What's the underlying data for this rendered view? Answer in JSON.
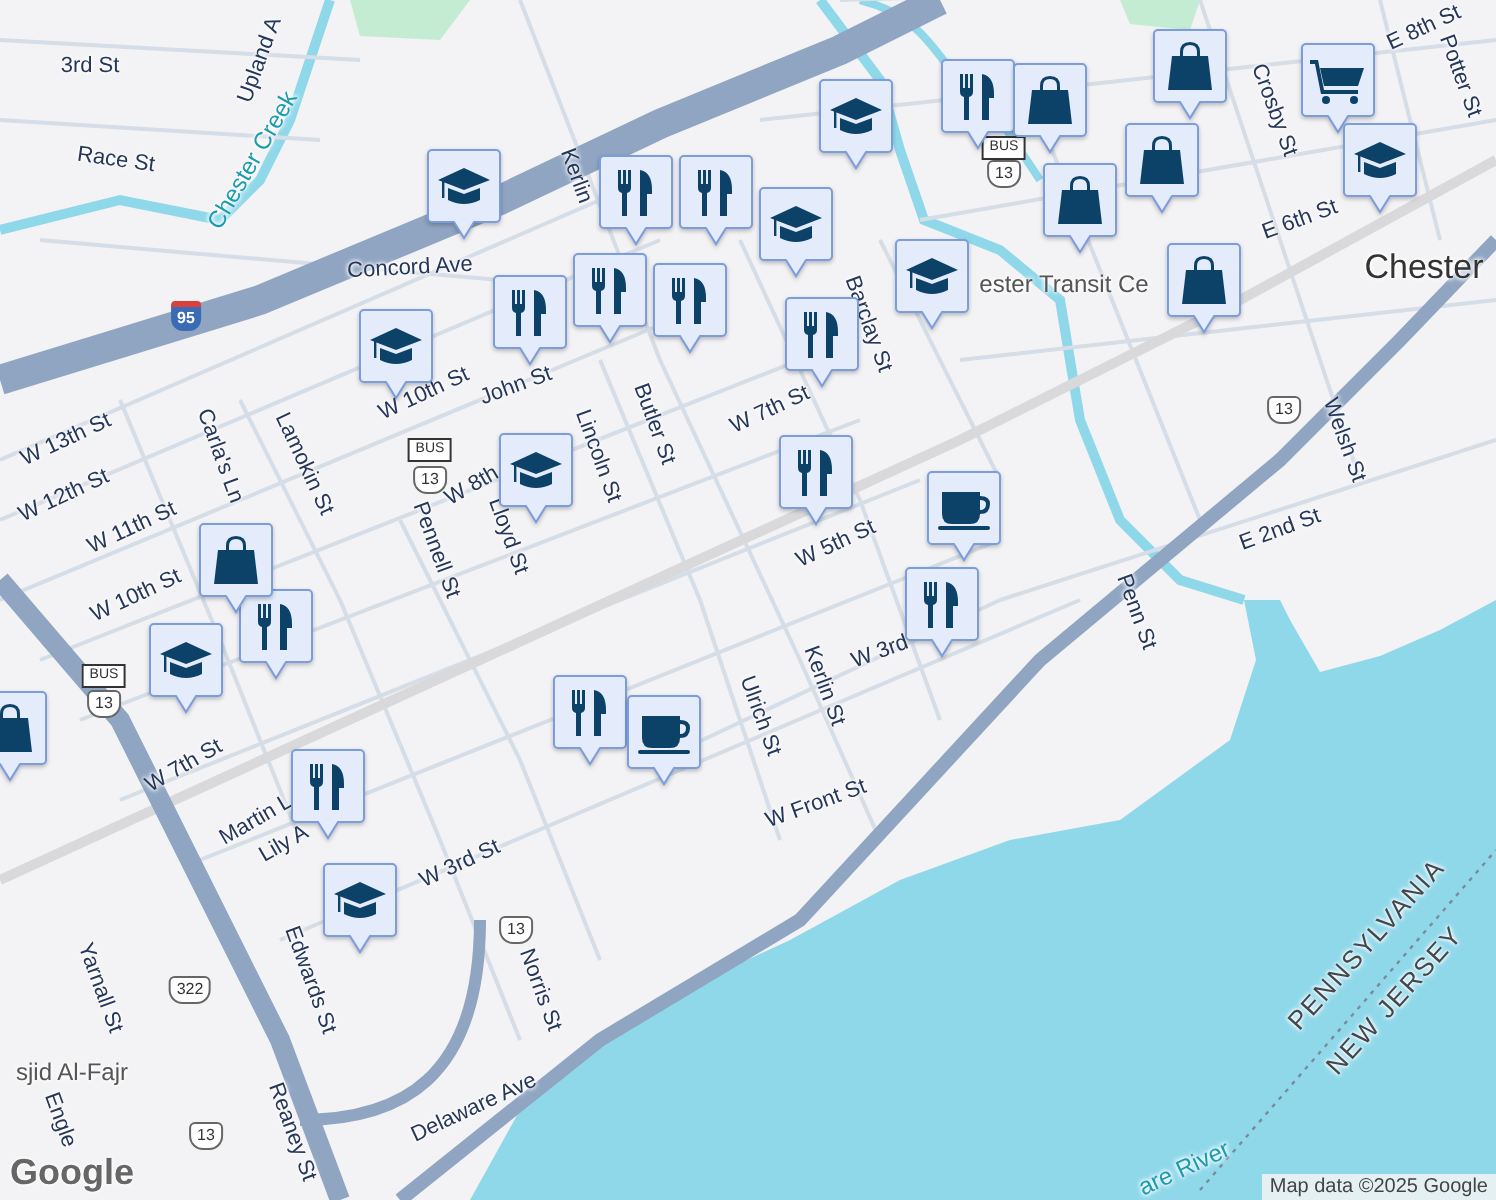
{
  "map": {
    "labels": [
      {
        "text": "3rd St",
        "kind": "street"
      },
      {
        "text": "Race St",
        "kind": "street"
      },
      {
        "text": "Upland A",
        "kind": "street"
      },
      {
        "text": "Chester Creek",
        "kind": "water"
      },
      {
        "text": "Concord Ave",
        "kind": "street"
      },
      {
        "text": "Kerlin",
        "kind": "street"
      },
      {
        "text": "W 10th St",
        "kind": "street"
      },
      {
        "text": "John St",
        "kind": "street"
      },
      {
        "text": "Lamokin St",
        "kind": "street"
      },
      {
        "text": "Carla's Ln",
        "kind": "street"
      },
      {
        "text": "W 13th St",
        "kind": "street"
      },
      {
        "text": "W 12th St",
        "kind": "street"
      },
      {
        "text": "W 11th St",
        "kind": "street"
      },
      {
        "text": "W 10th St",
        "kind": "street"
      },
      {
        "text": "Pennell St",
        "kind": "street"
      },
      {
        "text": "W 8th",
        "kind": "street"
      },
      {
        "text": "Lloyd St",
        "kind": "street"
      },
      {
        "text": "Lincoln St",
        "kind": "street"
      },
      {
        "text": "Butler St",
        "kind": "street"
      },
      {
        "text": "W 7th St",
        "kind": "street"
      },
      {
        "text": "W 5th St",
        "kind": "street"
      },
      {
        "text": "Barclay St",
        "kind": "street"
      },
      {
        "text": "ester Transit Ce",
        "kind": "place"
      },
      {
        "text": "Chester",
        "kind": "city"
      },
      {
        "text": "E 6th St",
        "kind": "street"
      },
      {
        "text": "E 8th St",
        "kind": "street"
      },
      {
        "text": "Potter St",
        "kind": "street"
      },
      {
        "text": "Crosby St",
        "kind": "street"
      },
      {
        "text": "Welsh St",
        "kind": "street"
      },
      {
        "text": "E 2nd St",
        "kind": "street"
      },
      {
        "text": "Penn St",
        "kind": "street"
      },
      {
        "text": "Kerlin St",
        "kind": "street"
      },
      {
        "text": "Ulrich St",
        "kind": "street"
      },
      {
        "text": "W 3rd",
        "kind": "street"
      },
      {
        "text": "W Front St",
        "kind": "street"
      },
      {
        "text": "W 7th St",
        "kind": "street"
      },
      {
        "text": "Martin L",
        "kind": "street"
      },
      {
        "text": "Lily A",
        "kind": "street"
      },
      {
        "text": "W 3rd St",
        "kind": "street"
      },
      {
        "text": "Edwards St",
        "kind": "street"
      },
      {
        "text": "Norris St",
        "kind": "street"
      },
      {
        "text": "Yarnall St",
        "kind": "street"
      },
      {
        "text": "Delaware Ave",
        "kind": "street"
      },
      {
        "text": "Reaney St",
        "kind": "street"
      },
      {
        "text": "sjid Al-Fajr",
        "kind": "place"
      },
      {
        "text": "PENNSYLVANIA",
        "kind": "state"
      },
      {
        "text": "NEW JERSEY",
        "kind": "state"
      },
      {
        "text": "are River",
        "kind": "water"
      },
      {
        "text": "Engle",
        "kind": "street"
      }
    ],
    "shields": [
      {
        "text": "95",
        "kind": "interstate"
      },
      {
        "text": "BUS",
        "kind": "bus"
      },
      {
        "text": "13",
        "kind": "us"
      },
      {
        "text": "BUS",
        "kind": "bus"
      },
      {
        "text": "13",
        "kind": "us"
      },
      {
        "text": "13",
        "kind": "us"
      },
      {
        "text": "BUS",
        "kind": "bus"
      },
      {
        "text": "13",
        "kind": "us"
      },
      {
        "text": "322",
        "kind": "us"
      },
      {
        "text": "13",
        "kind": "us"
      },
      {
        "text": "13",
        "kind": "us"
      }
    ],
    "markers": [
      {
        "kind": "school"
      },
      {
        "kind": "school"
      },
      {
        "kind": "restaurant"
      },
      {
        "kind": "restaurant"
      },
      {
        "kind": "restaurant"
      },
      {
        "kind": "restaurant"
      },
      {
        "kind": "restaurant"
      },
      {
        "kind": "restaurant"
      },
      {
        "kind": "school"
      },
      {
        "kind": "school"
      },
      {
        "kind": "restaurant"
      },
      {
        "kind": "cafe"
      },
      {
        "kind": "restaurant"
      },
      {
        "kind": "restaurant"
      },
      {
        "kind": "cafe"
      },
      {
        "kind": "restaurant"
      },
      {
        "kind": "school"
      },
      {
        "kind": "school"
      },
      {
        "kind": "restaurant"
      },
      {
        "kind": "shopping"
      },
      {
        "kind": "shopping"
      },
      {
        "kind": "school"
      },
      {
        "kind": "restaurant"
      },
      {
        "kind": "shopping"
      },
      {
        "kind": "shopping"
      },
      {
        "kind": "grocery"
      },
      {
        "kind": "shopping"
      },
      {
        "kind": "shopping"
      },
      {
        "kind": "school"
      },
      {
        "kind": "shopping"
      },
      {
        "kind": "school"
      }
    ],
    "logo": "Google",
    "attribution": "Map data ©2025 Google"
  }
}
